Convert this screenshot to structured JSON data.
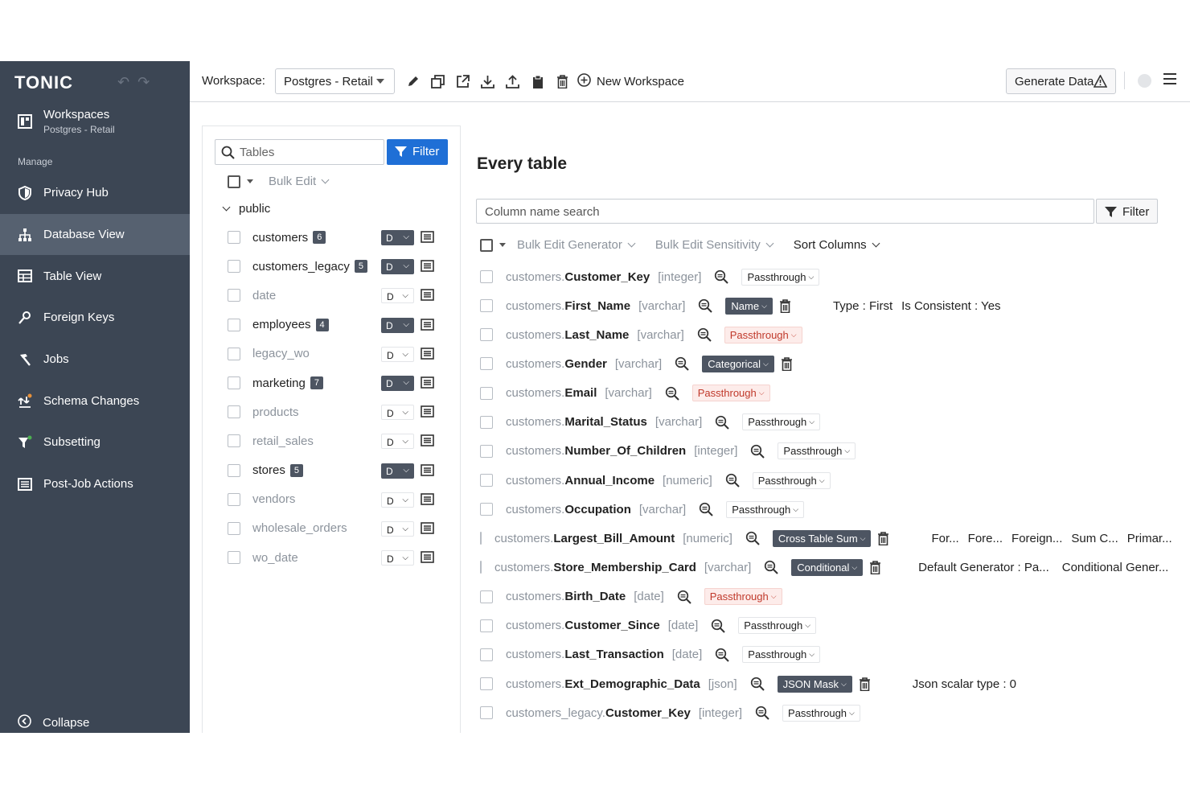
{
  "sidebar": {
    "logo": "TONIC",
    "workspace": {
      "title": "Workspaces",
      "subtitle": "Postgres - Retail"
    },
    "manage_label": "Manage",
    "items": [
      {
        "label": "Privacy Hub",
        "icon": "shield-icon"
      },
      {
        "label": "Database View",
        "icon": "hierarchy-icon",
        "active": true
      },
      {
        "label": "Table View",
        "icon": "table-icon"
      },
      {
        "label": "Foreign Keys",
        "icon": "key-icon"
      },
      {
        "label": "Jobs",
        "icon": "hammer-icon"
      },
      {
        "label": "Schema Changes",
        "icon": "schema-changes-icon"
      },
      {
        "label": "Subsetting",
        "icon": "funnel-icon"
      },
      {
        "label": "Post-Job Actions",
        "icon": "list-icon"
      }
    ],
    "collapse_label": "Collapse"
  },
  "topbar": {
    "workspace_label": "Workspace:",
    "workspace_value": "Postgres - Retail",
    "new_workspace": "New Workspace",
    "generate": "Generate Data"
  },
  "tables_panel": {
    "search_placeholder": "Tables",
    "filter_label": "Filter",
    "bulk_edit": "Bulk Edit",
    "schema": "public",
    "tables": [
      {
        "name": "customers",
        "count": "6",
        "mode": "D",
        "dim": false
      },
      {
        "name": "customers_legacy",
        "count": "5",
        "mode": "D",
        "dim": false
      },
      {
        "name": "date",
        "count": "",
        "mode": "D",
        "dim": true
      },
      {
        "name": "employees",
        "count": "4",
        "mode": "D",
        "dim": false
      },
      {
        "name": "legacy_wo",
        "count": "",
        "mode": "D",
        "dim": true
      },
      {
        "name": "marketing",
        "count": "7",
        "mode": "D",
        "dim": false
      },
      {
        "name": "products",
        "count": "",
        "mode": "D",
        "dim": true
      },
      {
        "name": "retail_sales",
        "count": "",
        "mode": "D",
        "dim": true
      },
      {
        "name": "stores",
        "count": "5",
        "mode": "D",
        "dim": false
      },
      {
        "name": "vendors",
        "count": "",
        "mode": "D",
        "dim": true
      },
      {
        "name": "wholesale_orders",
        "count": "",
        "mode": "D",
        "dim": true
      },
      {
        "name": "wo_date",
        "count": "",
        "mode": "D",
        "dim": true
      }
    ]
  },
  "main": {
    "title": "Every table",
    "search_placeholder": "Column name search",
    "filter_label": "Filter",
    "bulk_generator": "Bulk Edit Generator",
    "bulk_sensitivity": "Bulk Edit Sensitivity",
    "sort_columns": "Sort Columns",
    "columns": [
      {
        "table": "customers.",
        "column": "Customer_Key",
        "type": "[integer]",
        "generator": "Passthrough",
        "style": "plain",
        "trash": false,
        "extras": []
      },
      {
        "table": "customers.",
        "column": "First_Name",
        "type": "[varchar]",
        "generator": "Name",
        "style": "dark",
        "trash": true,
        "extras": [
          "Type : First",
          "Is Consistent : Yes"
        ]
      },
      {
        "table": "customers.",
        "column": "Last_Name",
        "type": "[varchar]",
        "generator": "Passthrough",
        "style": "red",
        "trash": false,
        "extras": []
      },
      {
        "table": "customers.",
        "column": "Gender",
        "type": "[varchar]",
        "generator": "Categorical",
        "style": "dark",
        "trash": true,
        "extras": []
      },
      {
        "table": "customers.",
        "column": "Email",
        "type": "[varchar]",
        "generator": "Passthrough",
        "style": "red",
        "trash": false,
        "extras": []
      },
      {
        "table": "customers.",
        "column": "Marital_Status",
        "type": "[varchar]",
        "generator": "Passthrough",
        "style": "plain",
        "trash": false,
        "extras": []
      },
      {
        "table": "customers.",
        "column": "Number_Of_Children",
        "type": "[integer]",
        "generator": "Passthrough",
        "style": "plain",
        "trash": false,
        "extras": []
      },
      {
        "table": "customers.",
        "column": "Annual_Income",
        "type": "[numeric]",
        "generator": "Passthrough",
        "style": "plain",
        "trash": false,
        "extras": []
      },
      {
        "table": "customers.",
        "column": "Occupation",
        "type": "[varchar]",
        "generator": "Passthrough",
        "style": "plain",
        "trash": false,
        "extras": []
      },
      {
        "table": "customers.",
        "column": "Largest_Bill_Amount",
        "type": "[numeric]",
        "generator": "Cross Table Sum",
        "style": "dark",
        "trash": true,
        "extras": [
          "For...",
          "Fore...",
          "Foreign...",
          "Sum C...",
          "Primar..."
        ]
      },
      {
        "table": "customers.",
        "column": "Store_Membership_Card",
        "type": "[varchar]",
        "generator": "Conditional",
        "style": "dark",
        "trash": true,
        "extras": [
          "Default Generator : Pa...",
          "Conditional Gener..."
        ]
      },
      {
        "table": "customers.",
        "column": "Birth_Date",
        "type": "[date]",
        "generator": "Passthrough",
        "style": "red",
        "trash": false,
        "extras": []
      },
      {
        "table": "customers.",
        "column": "Customer_Since",
        "type": "[date]",
        "generator": "Passthrough",
        "style": "plain",
        "trash": false,
        "extras": []
      },
      {
        "table": "customers.",
        "column": "Last_Transaction",
        "type": "[date]",
        "generator": "Passthrough",
        "style": "plain",
        "trash": false,
        "extras": []
      },
      {
        "table": "customers.",
        "column": "Ext_Demographic_Data",
        "type": "[json]",
        "generator": "JSON Mask",
        "style": "dark",
        "trash": true,
        "extras": [
          "Json scalar type : 0"
        ]
      },
      {
        "table": "customers_legacy.",
        "column": "Customer_Key",
        "type": "[integer]",
        "generator": "Passthrough",
        "style": "plain",
        "trash": false,
        "extras": []
      }
    ]
  },
  "colors": {
    "sidebar": "#3c4654",
    "active": "#566170",
    "accent": "#1f6fd6",
    "badge": "#4d5562",
    "sensitive": "#c0392b"
  }
}
